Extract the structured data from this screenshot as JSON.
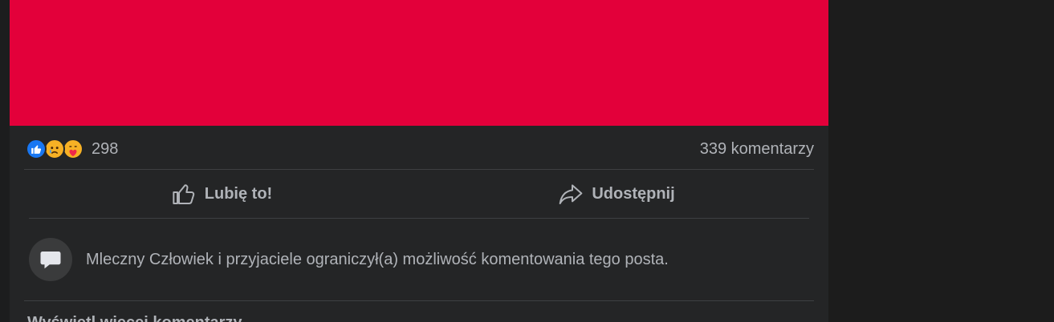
{
  "post": {
    "media_color": "#e3003a",
    "reactions": {
      "icons": [
        "like-icon",
        "sad-icon",
        "care-icon"
      ],
      "count": "298"
    },
    "comments_count": "339 komentarzy",
    "actions": {
      "like_label": "Lubię to!",
      "share_label": "Udostępnij"
    },
    "restriction_notice": "Mleczny Człowiek i przyjaciele ograniczył(a) możliwość komentowania tego posta.",
    "cut_off_text": "Wyświetl więcej komentarzy"
  },
  "colors": {
    "background": "#18191a",
    "card": "#242526",
    "text_secondary": "#b0b3b8",
    "like_blue": "#1877f2"
  }
}
